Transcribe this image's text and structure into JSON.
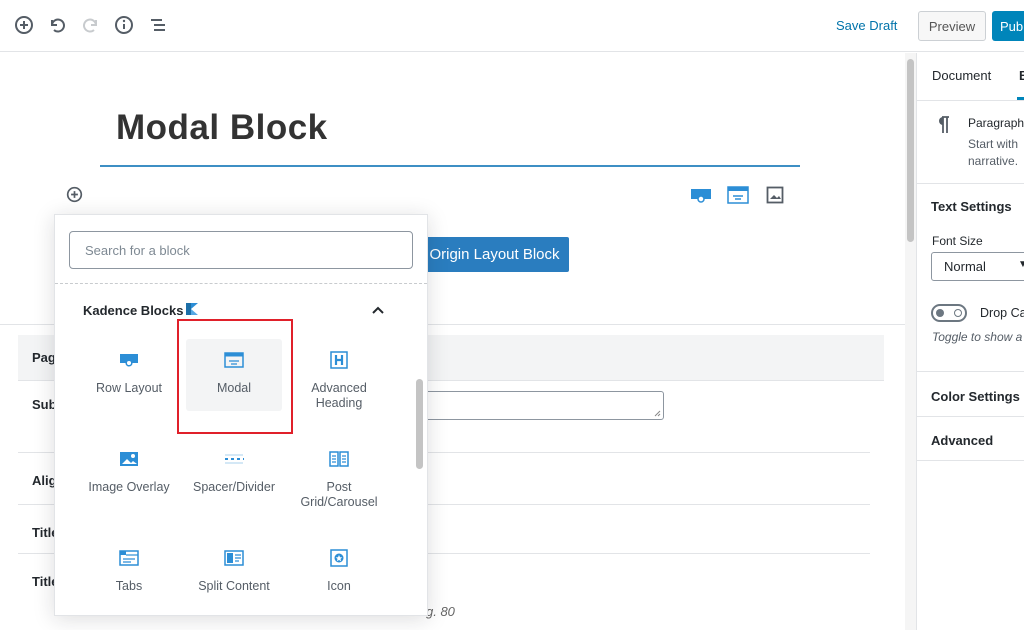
{
  "toolbar": {
    "icons": [
      "add-block-icon",
      "undo-icon",
      "redo-icon",
      "info-icon",
      "outline-icon"
    ],
    "save_draft": "Save Draft",
    "preview": "Preview",
    "publish": "Pub"
  },
  "editor": {
    "title": "Modal Block",
    "block_icons": [
      "row-layout-icon",
      "modal-icon",
      "image-icon"
    ],
    "origin_button": "Origin Layout Block",
    "meta": {
      "header_label": "Pag",
      "rows": [
        "Sub",
        "Alig",
        "Title",
        "Title"
      ],
      "hint": "g. 80"
    }
  },
  "inserter": {
    "search_placeholder": "Search for a block",
    "panel_title": "Kadence Blocks",
    "blocks": [
      {
        "label": "Row Layout",
        "icon": "row-layout-icon"
      },
      {
        "label": "Modal",
        "icon": "modal-icon"
      },
      {
        "label": "Advanced Heading",
        "icon": "heading-icon"
      },
      {
        "label": "Image Overlay",
        "icon": "image-overlay-icon"
      },
      {
        "label": "Spacer/Divider",
        "icon": "spacer-icon"
      },
      {
        "label": "Post Grid/Carousel",
        "icon": "post-grid-icon"
      },
      {
        "label": "Tabs",
        "icon": "tabs-icon"
      },
      {
        "label": "Split Content",
        "icon": "split-content-icon"
      },
      {
        "label": "Icon",
        "icon": "icon-block-icon"
      }
    ]
  },
  "sidebar": {
    "tabs": [
      "Document",
      "B"
    ],
    "block_name": "Paragraph",
    "block_desc_1": "Start with",
    "block_desc_2": "narrative.",
    "text_settings": "Text Settings",
    "font_size_label": "Font Size",
    "font_size_value": "Normal",
    "drop_cap_label": "Drop Ca",
    "drop_cap_hint": "Toggle to show a",
    "color_settings": "Color Settings",
    "advanced": "Advanced"
  },
  "colors": {
    "accent": "#0085ba",
    "link": "#0073aa",
    "block_icon": "#2c8ed6",
    "highlight_box": "#e0202a"
  }
}
